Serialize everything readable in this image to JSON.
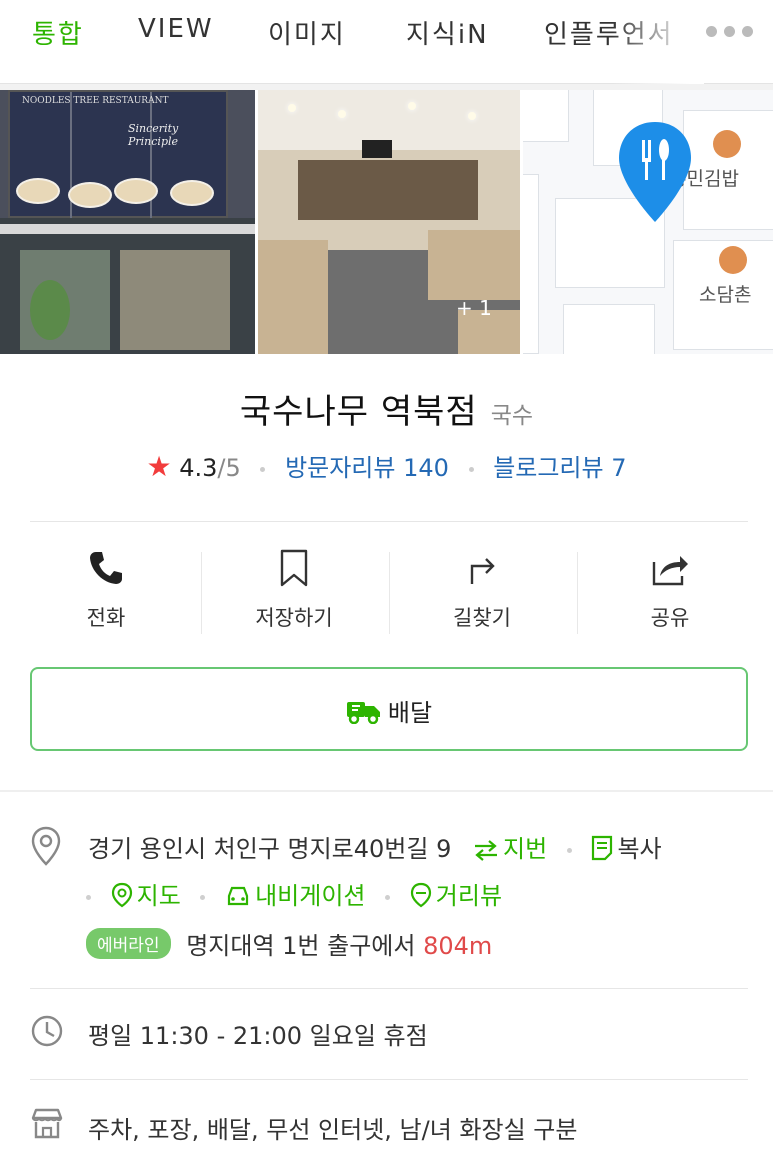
{
  "tabs": [
    {
      "label": "통합",
      "active": true
    },
    {
      "label": "VIEW",
      "active": false
    },
    {
      "label": "이미지",
      "active": false
    },
    {
      "label": "지식iN",
      "active": false
    },
    {
      "label": "인플루언서",
      "active": false
    }
  ],
  "photos": {
    "storefront_sign": "NOODLES TREE RESTAURANT",
    "storefront_script": "Sincerity Principle",
    "more_count": "+ 1",
    "map_pois": [
      "홍민김밥",
      "소담촌"
    ]
  },
  "place": {
    "name": "국수나무 역북점",
    "category": "국수",
    "rating": "4.3",
    "rating_max": "/5",
    "visitor_reviews": "방문자리뷰 140",
    "blog_reviews": "블로그리뷰 7"
  },
  "actions": {
    "call": "전화",
    "save": "저장하기",
    "directions": "길찾기",
    "share": "공유"
  },
  "delivery_label": "배달",
  "address": {
    "text": "경기 용인시 처인구 명지로40번길 9",
    "lot_number": "지번",
    "copy": "복사",
    "map": "지도",
    "navigation": "내비게이션",
    "street_view": "거리뷰"
  },
  "transit": {
    "line": "에버라인",
    "station": "명지대역 1번 출구에서",
    "distance": "804m"
  },
  "hours": "평일 11:30 - 21:00 일요일 휴점",
  "amenities": "주차, 포장, 배달, 무선 인터넷, 남/녀 화장실 구분",
  "colors": {
    "brand_green": "#2db400",
    "link_blue": "#2469b4",
    "star_red": "#f23c3c",
    "distance_red": "#e04a4a",
    "map_marker_blue": "#1d8ee8"
  }
}
